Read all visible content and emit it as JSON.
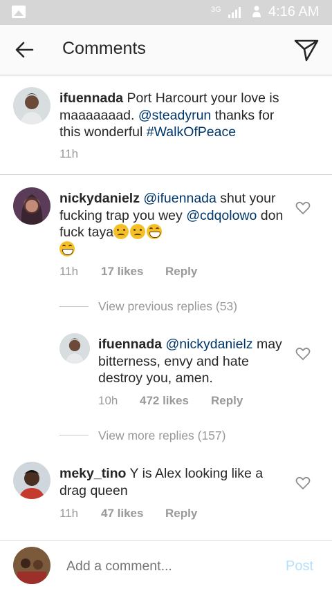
{
  "status_bar": {
    "network": "3G",
    "time": "4:16 AM"
  },
  "header": {
    "title": "Comments",
    "back_icon": "arrow-left-icon",
    "send_icon": "paper-plane-icon"
  },
  "caption": {
    "username": "ifuennada",
    "text_1": " Port Harcourt your love is maaaaaaad. ",
    "mention": "@steadyrun",
    "text_2": " thanks for this wonderful ",
    "hashtag": "#WalkOfPeace",
    "time": "11h"
  },
  "comments": [
    {
      "username": "nickydanielz",
      "mention_1": "@ifuennada",
      "text_1": " shut your fucking trap you wey ",
      "mention_2": "@cdqolowo",
      "text_2": " don fuck taya",
      "emoji_icons": [
        "confused-face-icon",
        "confused-face-icon",
        "grinning-face-icon",
        "grinning-face-icon"
      ],
      "time": "11h",
      "likes": "17 likes",
      "reply": "Reply"
    },
    {
      "username": "meky_tino",
      "text": " Y is Alex looking like a drag queen",
      "time": "11h",
      "likes": "47 likes",
      "reply": "Reply"
    }
  ],
  "reply_thread": {
    "view_previous": "View previous replies (53)",
    "reply": {
      "username": "ifuennada",
      "mention": "@nickydanielz",
      "text": " may bitterness,  envy and hate  destroy you, amen.",
      "time": "10h",
      "likes": "472 likes",
      "reply": "Reply"
    },
    "view_more": "View more replies (157)"
  },
  "composer": {
    "placeholder": "Add a comment...",
    "post_label": "Post"
  },
  "colors": {
    "link": "#003569",
    "post_disabled": "#b2dffc",
    "meta": "#999999"
  }
}
